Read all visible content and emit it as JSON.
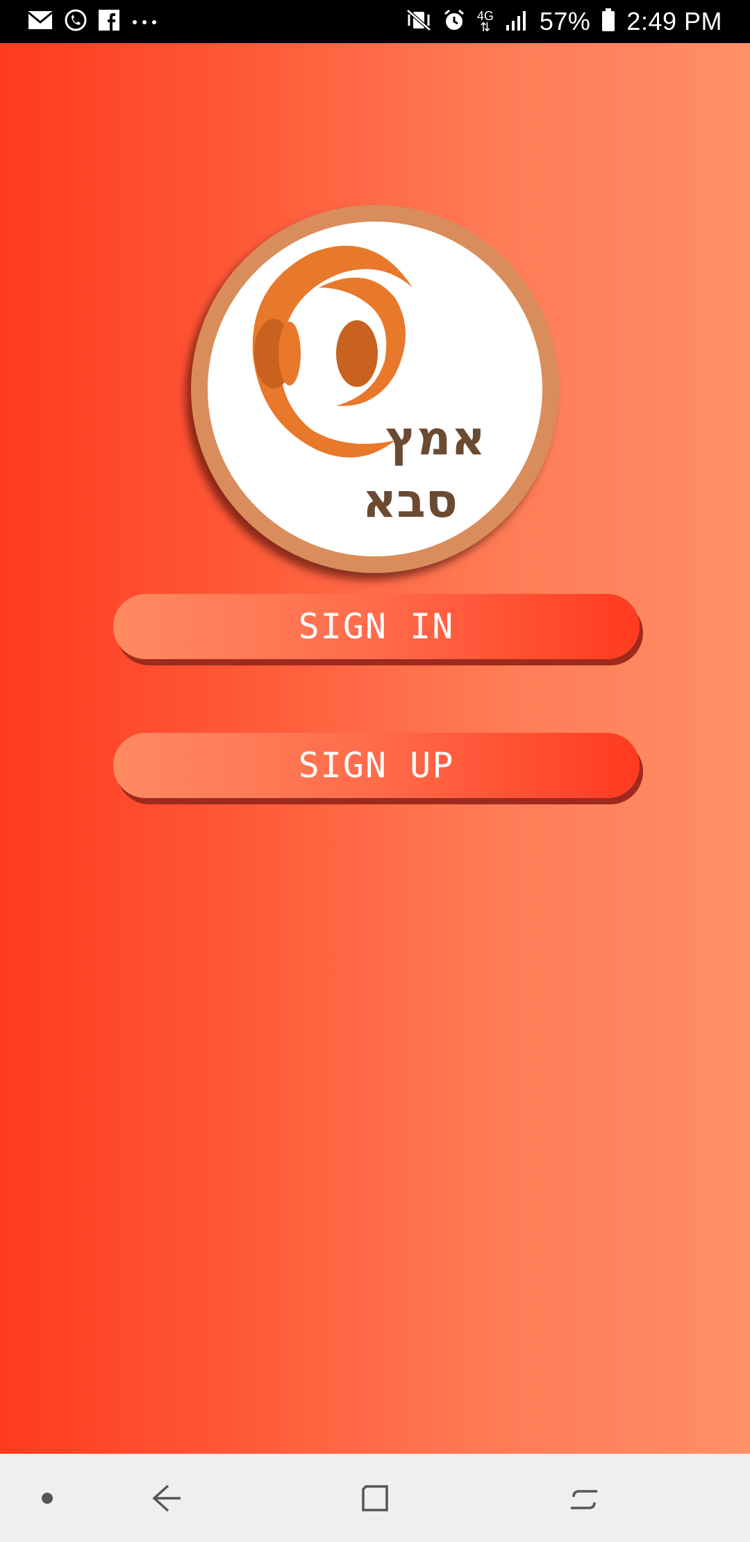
{
  "status_bar": {
    "left_icons": [
      "gmail-icon",
      "phone-call-icon",
      "facebook-icon",
      "more-dots-icon"
    ],
    "network": "4G",
    "battery_percent": "57%",
    "time": "2:49 PM",
    "right_icons": [
      "vibrate-mute-icon",
      "alarm-icon",
      "network-arrows-icon",
      "signal-icon",
      "battery-icon"
    ]
  },
  "logo": {
    "text_line1": "אמץ",
    "text_line2": "סבא",
    "colors": {
      "ring": "#d98d5c",
      "orange": "#e8782a",
      "dark_orange": "#c8621e",
      "text": "#6b4a32"
    }
  },
  "buttons": {
    "sign_in": "SIGN IN",
    "sign_up": "SIGN UP"
  },
  "nav_bar": {
    "items": [
      "dot-icon",
      "back-icon",
      "home-icon",
      "recents-icon"
    ]
  },
  "colors": {
    "gradient_left": "#ff3a20",
    "gradient_right": "#ff9068",
    "button_shadow": "#9e2a1e"
  }
}
